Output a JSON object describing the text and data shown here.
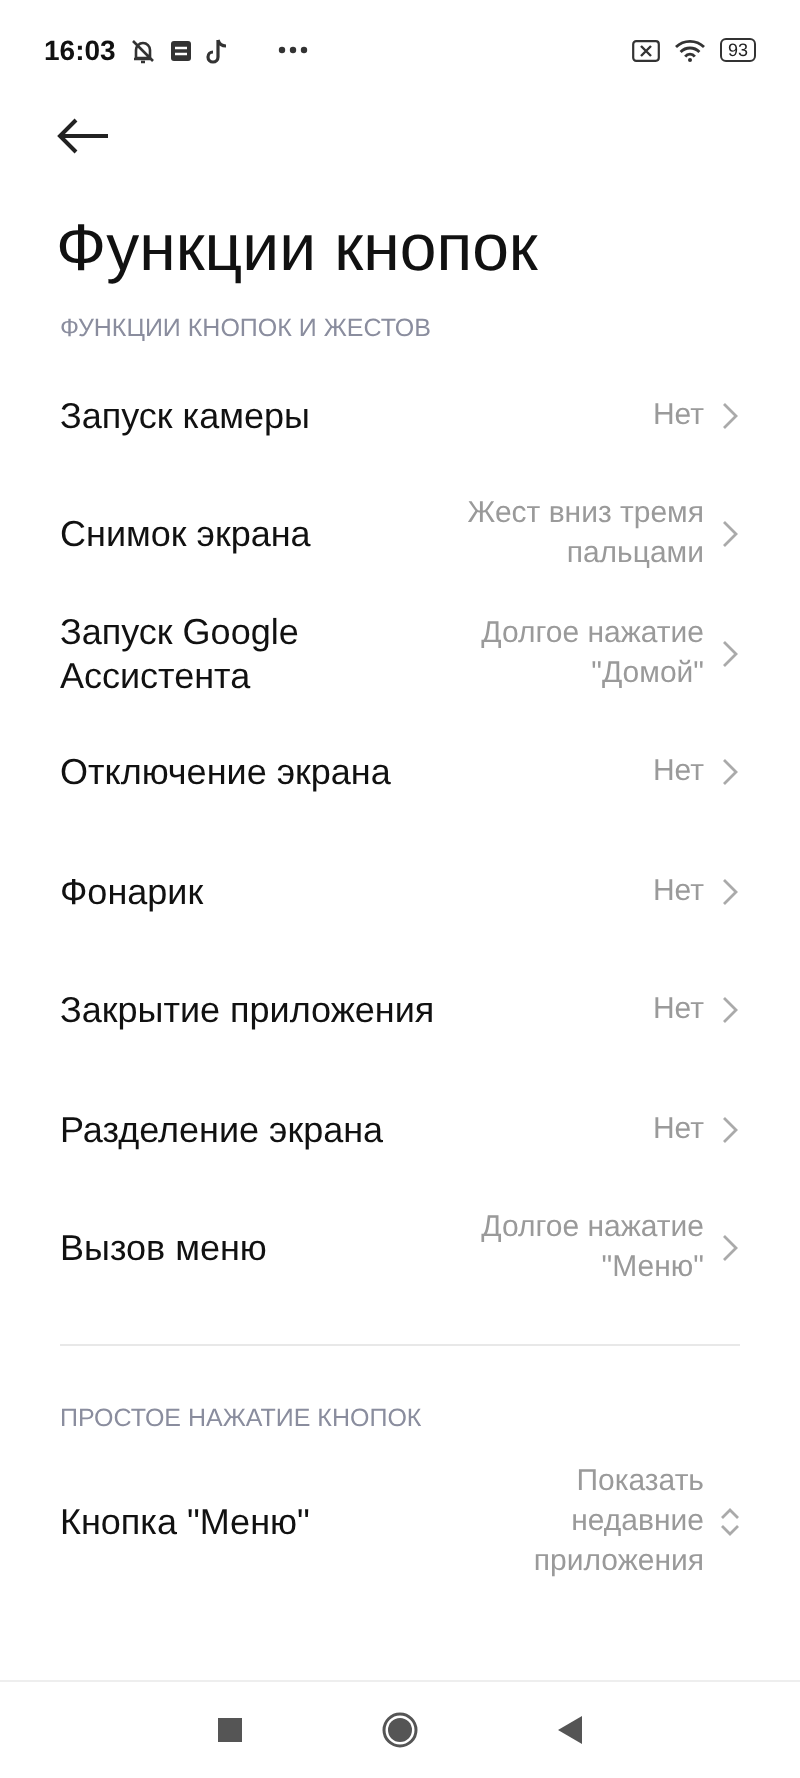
{
  "status_bar": {
    "time": "16:03",
    "battery": "93"
  },
  "title": "Функции кнопок",
  "sections": [
    {
      "header": "ФУНКЦИИ КНОПОК И ЖЕСТОВ",
      "rows": [
        {
          "kind": "chevron",
          "title": "Запуск камеры",
          "value": "Нет"
        },
        {
          "kind": "chevron",
          "title": "Снимок экрана",
          "value": "Жест вниз тремя пальцами"
        },
        {
          "kind": "chevron",
          "title": "Запуск Google Ассистента",
          "value": "Долгое нажатие \"Домой\""
        },
        {
          "kind": "chevron",
          "title": "Отключение экрана",
          "value": "Нет"
        },
        {
          "kind": "chevron",
          "title": "Фонарик",
          "value": "Нет"
        },
        {
          "kind": "chevron",
          "title": "Закрытие приложения",
          "value": "Нет"
        },
        {
          "kind": "chevron",
          "title": "Разделение экрана",
          "value": "Нет"
        },
        {
          "kind": "chevron",
          "title": "Вызов меню",
          "value": "Долгое нажатие \"Меню\""
        }
      ]
    },
    {
      "header": "ПРОСТОЕ НАЖАТИЕ КНОПОК",
      "rows": [
        {
          "kind": "spinner",
          "title": "Кнопка \"Меню\"",
          "value": "Показать недавние приложения"
        }
      ]
    }
  ]
}
